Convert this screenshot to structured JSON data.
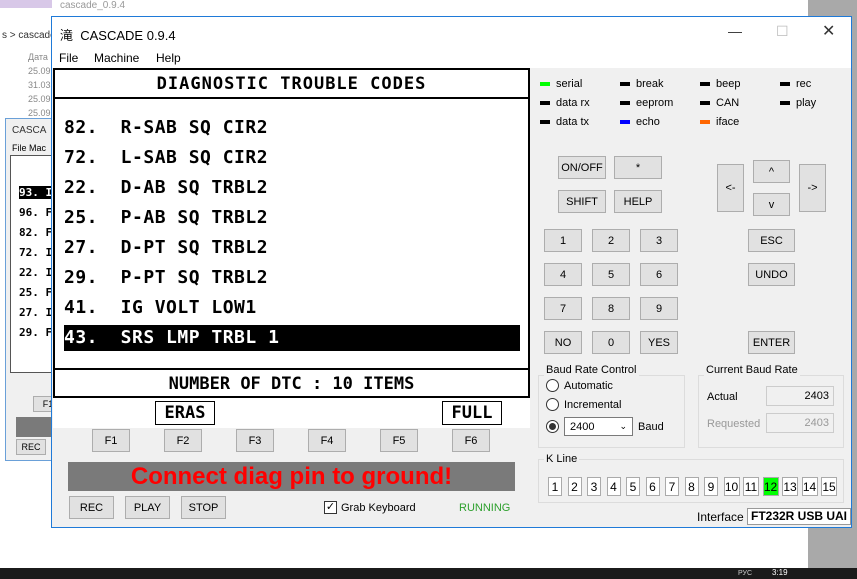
{
  "background": {
    "explorer_title": "cascade_0.9.4",
    "breadcrumb": "s  >  cascade_",
    "date_header": "Дата",
    "dates": [
      "25.09.",
      "31.03.",
      "25.09.",
      "25.09."
    ],
    "second_window": {
      "title": "CASCA",
      "menu": "File  Mac",
      "lines": [
        "93. I",
        "96. F",
        "82. F",
        "72. I",
        "22. I",
        "25. F",
        "27. I",
        "29. F"
      ],
      "f1": "F1",
      "rec": "REC"
    },
    "clock": "3:19",
    "lang": "РУС"
  },
  "window": {
    "title": "CASCADE 0.9.4",
    "app_icon": "滝",
    "menu": [
      "File",
      "Machine",
      "Help"
    ]
  },
  "screen": {
    "header": "DIAGNOSTIC TROUBLE CODES",
    "codes": [
      "82.  R-SAB SQ CIR2",
      "72.  L-SAB SQ CIR2",
      "22.  D-AB SQ TRBL2",
      "25.  P-AB SQ TRBL2",
      "27.  D-PT SQ TRBL2",
      "29.  P-PT SQ TRBL2",
      "41.  IG VOLT LOW1",
      "43.  SRS LMP TRBL 1"
    ],
    "selected_index": 7,
    "footer": "NUMBER OF DTC  : 10 ITEMS",
    "soft_left": "ERAS",
    "soft_right": "FULL"
  },
  "fkeys": [
    "F1",
    "F2",
    "F3",
    "F4",
    "F5",
    "F6"
  ],
  "banner": "Connect diag pin to ground!",
  "bottom": {
    "rec": "REC",
    "play": "PLAY",
    "stop": "STOP",
    "grab_keyboard": "Grab Keyboard",
    "grab_checked": true,
    "status": "RUNNING"
  },
  "indicators": [
    {
      "label": "serial",
      "color": "#00ff00"
    },
    {
      "label": "break",
      "color": "#000000"
    },
    {
      "label": "beep",
      "color": "#000000"
    },
    {
      "label": "rec",
      "color": "#000000"
    },
    {
      "label": "data rx",
      "color": "#000000"
    },
    {
      "label": "eeprom",
      "color": "#000000"
    },
    {
      "label": "CAN",
      "color": "#000000"
    },
    {
      "label": "play",
      "color": "#000000"
    },
    {
      "label": "data tx",
      "color": "#000000"
    },
    {
      "label": "echo",
      "color": "#0000ff"
    },
    {
      "label": "iface",
      "color": "#ff6600"
    }
  ],
  "keys": {
    "onoff": "ON/OFF",
    "star": "*",
    "shift": "SHIFT",
    "help": "HELP",
    "left": "<-",
    "up": "^",
    "down": "v",
    "right": "->",
    "digits": [
      "1",
      "2",
      "3",
      "4",
      "5",
      "6",
      "7",
      "8",
      "9"
    ],
    "no": "NO",
    "zero": "0",
    "yes": "YES",
    "esc": "ESC",
    "undo": "UNDO",
    "enter": "ENTER"
  },
  "baud_control": {
    "title": "Baud Rate Control",
    "automatic": "Automatic",
    "incremental": "Incremental",
    "value": "2400",
    "unit": "Baud",
    "selected": "manual"
  },
  "current_baud": {
    "title": "Current Baud Rate",
    "actual_label": "Actual",
    "actual": "2403",
    "requested_label": "Requested",
    "requested": "2403"
  },
  "kline": {
    "title": "K Line",
    "lines": [
      "1",
      "2",
      "3",
      "4",
      "5",
      "6",
      "7",
      "8",
      "9",
      "10",
      "11",
      "12",
      "13",
      "14",
      "15"
    ],
    "active": "12",
    "active_color": "#00ff00"
  },
  "interface": {
    "label": "Interface",
    "value": "FT232R USB UAI"
  }
}
